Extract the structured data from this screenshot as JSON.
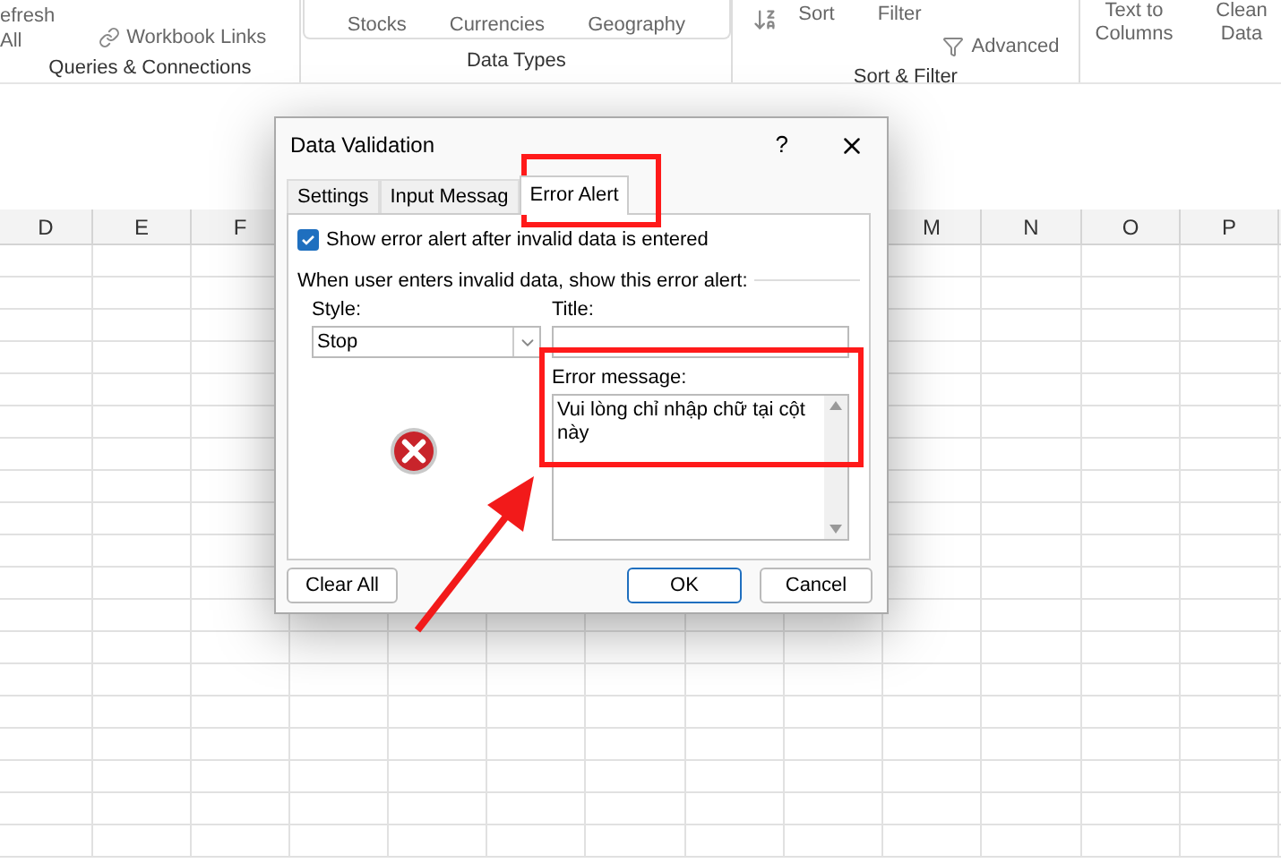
{
  "ribbon": {
    "groups": [
      {
        "label": "Queries & Connections",
        "items": [
          "efresh",
          "All",
          "Workbook Links"
        ]
      },
      {
        "label": "Data Types",
        "items": [
          "Stocks",
          "Currencies",
          "Geography"
        ]
      },
      {
        "label": "Sort & Filter",
        "items": [
          "Sort",
          "Filter",
          "Advanced"
        ]
      },
      {
        "items": [
          "Text to Columns",
          "Clean Data"
        ]
      }
    ]
  },
  "columns": [
    "D",
    "E",
    "F",
    "M",
    "N",
    "O",
    "P"
  ],
  "dialog": {
    "title": "Data Validation",
    "help": "?",
    "tabs": [
      {
        "label": "Settings",
        "selected": false
      },
      {
        "label": "Input Messag",
        "selected": false
      },
      {
        "label": "Error Alert",
        "selected": true
      }
    ],
    "show_alert": {
      "label": "Show error alert after invalid data is entered",
      "checked": true
    },
    "caption": "When user enters invalid data, show this error alert:",
    "style": {
      "label": "Style:",
      "value": "Stop"
    },
    "title_field": {
      "label": "Title:"
    },
    "message": {
      "label": "Error message:",
      "value": "Vui lòng chỉ nhập chữ tại cột này"
    },
    "buttons": {
      "clear": "Clear All",
      "ok": "OK",
      "cancel": "Cancel"
    }
  }
}
